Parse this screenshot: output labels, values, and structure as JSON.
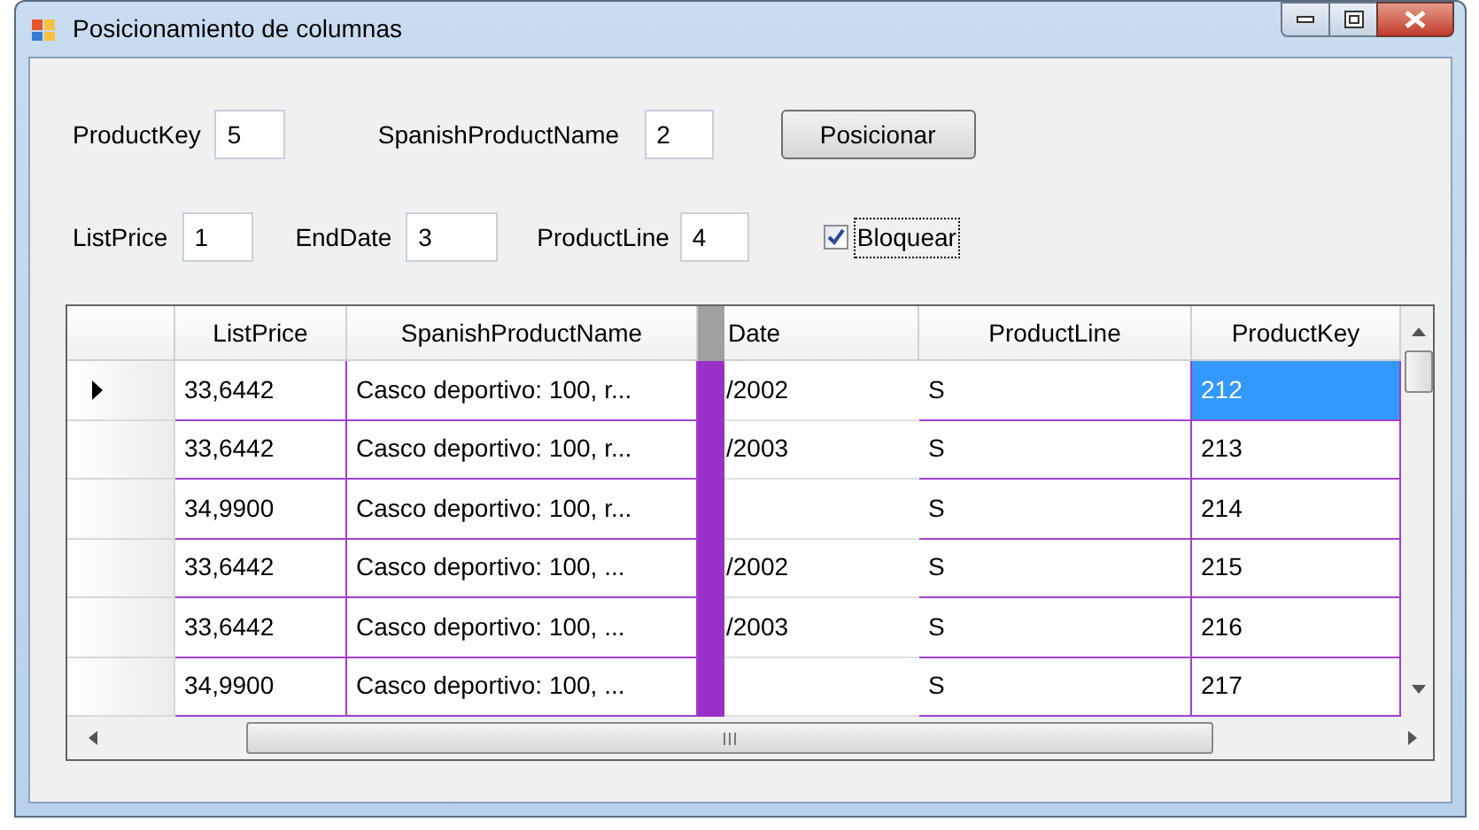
{
  "window": {
    "title": "Posicionamiento de columnas"
  },
  "form_row_1": {
    "fields": [
      {
        "label": "ProductKey",
        "value": "5"
      },
      {
        "label": "SpanishProductName",
        "value": "2"
      }
    ],
    "button": "Posicionar"
  },
  "form_row_2": {
    "fields": [
      {
        "label": "ListPrice",
        "value": "1"
      },
      {
        "label": "EndDate",
        "value": "3"
      },
      {
        "label": "ProductLine",
        "value": "4"
      }
    ],
    "checkbox": {
      "label": "Bloquear",
      "checked": true
    }
  },
  "grid": {
    "columns": [
      "ListPrice",
      "SpanishProductName",
      "Date",
      "ProductLine",
      "ProductKey"
    ],
    "rows": [
      {
        "current": true,
        "cells": [
          {
            "text": "33,6442",
            "selected": false
          },
          {
            "text": "Casco deportivo: 100, r...",
            "selected": false
          },
          {
            "text": "/2002",
            "selected": false
          },
          {
            "text": "S",
            "selected": false
          },
          {
            "text": "212",
            "selected": true
          }
        ]
      },
      {
        "current": false,
        "cells": [
          {
            "text": "33,6442",
            "selected": false
          },
          {
            "text": "Casco deportivo: 100, r...",
            "selected": false
          },
          {
            "text": "/2003",
            "selected": false
          },
          {
            "text": "S",
            "selected": false
          },
          {
            "text": "213",
            "selected": false
          }
        ]
      },
      {
        "current": false,
        "cells": [
          {
            "text": "34,9900",
            "selected": false
          },
          {
            "text": "Casco deportivo: 100, r...",
            "selected": false
          },
          {
            "selected": false
          },
          {
            "text": "S",
            "selected": false
          },
          {
            "text": "214",
            "selected": false
          }
        ]
      },
      {
        "current": false,
        "cells": [
          {
            "text": "33,6442",
            "selected": false
          },
          {
            "text": "Casco deportivo: 100, ...",
            "selected": false
          },
          {
            "text": "/2002",
            "selected": false
          },
          {
            "text": "S",
            "selected": false
          },
          {
            "text": "215",
            "selected": false
          }
        ]
      },
      {
        "current": false,
        "cells": [
          {
            "text": "33,6442",
            "selected": false
          },
          {
            "text": "Casco deportivo: 100, ...",
            "selected": false
          },
          {
            "text": "/2003",
            "selected": false
          },
          {
            "text": "S",
            "selected": false
          },
          {
            "text": "216",
            "selected": false
          }
        ]
      },
      {
        "current": false,
        "cells": [
          {
            "text": "34,9900",
            "selected": false
          },
          {
            "text": "Casco deportivo: 100, ...",
            "selected": false
          },
          {
            "selected": false
          },
          {
            "text": "S",
            "selected": false
          },
          {
            "text": "217",
            "selected": false
          }
        ]
      }
    ]
  }
}
